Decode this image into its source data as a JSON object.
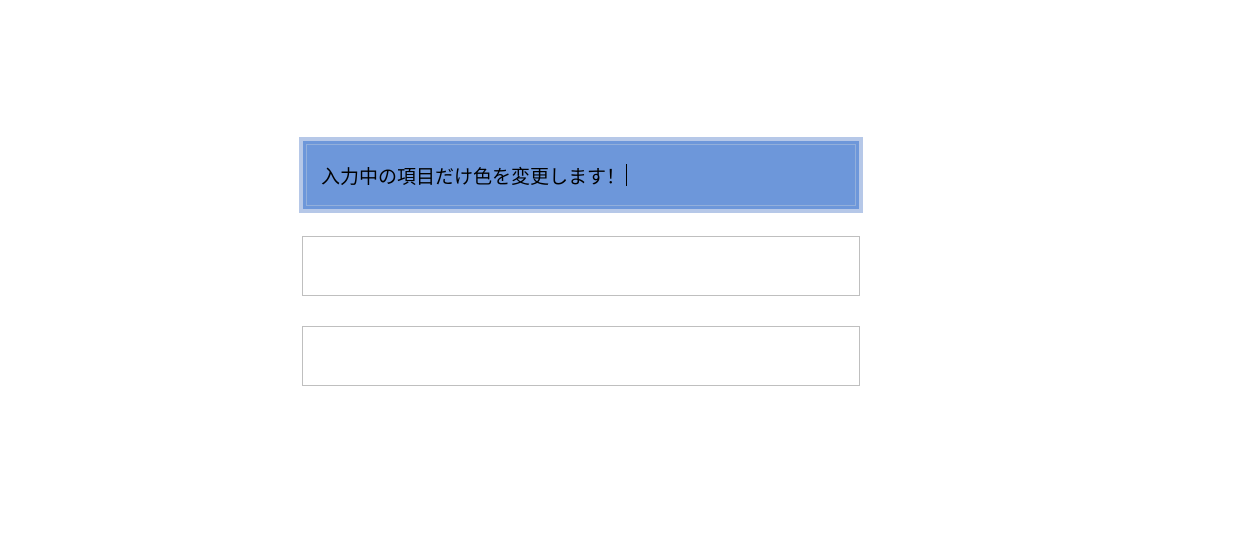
{
  "inputs": [
    {
      "value": "入力中の項目だけ色を変更します！",
      "focused": true
    },
    {
      "value": "",
      "focused": false
    },
    {
      "value": "",
      "focused": false
    }
  ]
}
